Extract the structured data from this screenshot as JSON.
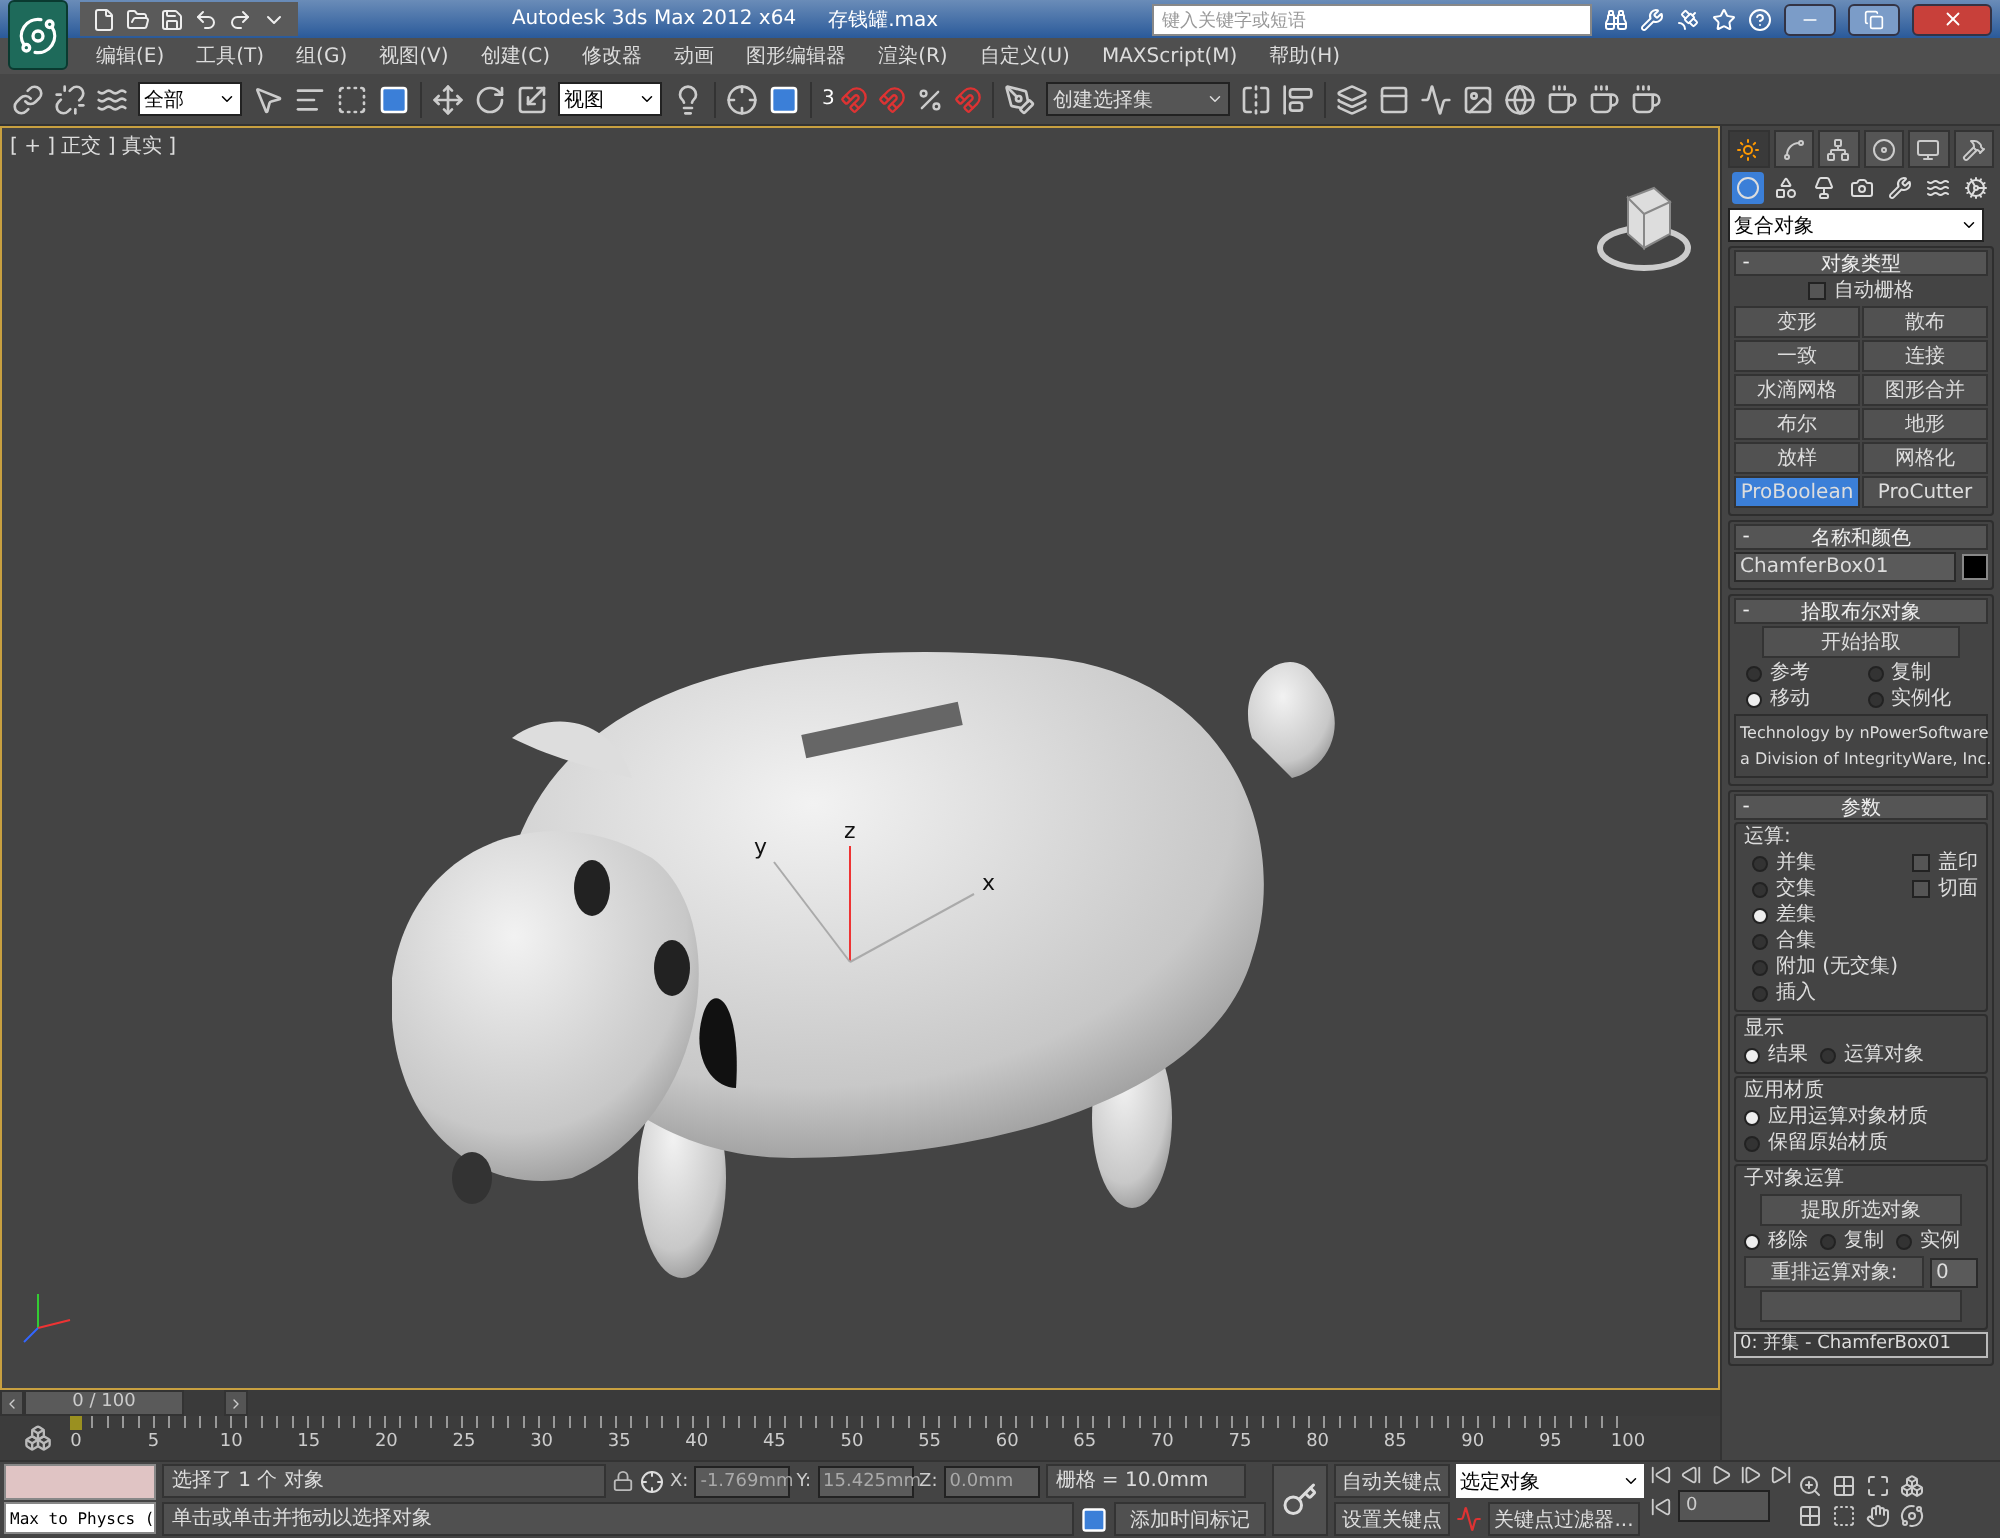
{
  "title_bar": {
    "app_title": "Autodesk 3ds Max  2012 x64",
    "file_name": "存钱罐.max",
    "search_placeholder": "键入关键字或短语"
  },
  "menu": [
    "编辑(E)",
    "工具(T)",
    "组(G)",
    "视图(V)",
    "创建(C)",
    "修改器",
    "动画",
    "图形编辑器",
    "渲染(R)",
    "自定义(U)",
    "MAXScript(M)",
    "帮助(H)"
  ],
  "toolbar": {
    "selection_filter": "全部",
    "reference_coord": "视图",
    "snap_label": "3",
    "named_selection": "创建选择集"
  },
  "viewport": {
    "label": "[ + ] 正交 ] 真实 ]",
    "gizmo_axes": [
      "x",
      "y",
      "z"
    ]
  },
  "command_panel": {
    "tabs": [
      {
        "kind": "create",
        "selected": true
      },
      {
        "kind": "modify",
        "selected": false
      },
      {
        "kind": "hierarchy",
        "selected": false
      },
      {
        "kind": "motion",
        "selected": false
      },
      {
        "kind": "display",
        "selected": false
      },
      {
        "kind": "utilities",
        "selected": false
      }
    ],
    "categories": [
      {
        "kind": "geometry",
        "selected": true
      },
      {
        "kind": "shapes",
        "selected": false
      },
      {
        "kind": "lights",
        "selected": false
      },
      {
        "kind": "cameras",
        "selected": false
      },
      {
        "kind": "helpers",
        "selected": false
      },
      {
        "kind": "spacewarps",
        "selected": false
      },
      {
        "kind": "systems",
        "selected": false
      }
    ],
    "dropdown": "复合对象",
    "object_type": {
      "mark": "-",
      "title": "对象类型",
      "auto_grid": {
        "label": "自动栅格",
        "checked": false
      },
      "buttons": [
        {
          "label": "变形",
          "selected": false
        },
        {
          "label": "散布",
          "selected": false
        },
        {
          "label": "一致",
          "selected": false
        },
        {
          "label": "连接",
          "selected": false
        },
        {
          "label": "水滴网格",
          "selected": false
        },
        {
          "label": "图形合并",
          "selected": false
        },
        {
          "label": "布尔",
          "selected": false
        },
        {
          "label": "地形",
          "selected": false
        },
        {
          "label": "放样",
          "selected": false
        },
        {
          "label": "网格化",
          "selected": false
        },
        {
          "label": "ProBoolean",
          "selected": true
        },
        {
          "label": "ProCutter",
          "selected": false
        }
      ]
    },
    "name_color": {
      "mark": "-",
      "title": "名称和颜色",
      "name": "ChamferBox01",
      "color": "#000000"
    },
    "pick": {
      "mark": "-",
      "title": "拾取布尔对象",
      "button": "开始拾取",
      "radios": [
        {
          "label": "参考",
          "selected": false
        },
        {
          "label": "复制",
          "selected": false
        },
        {
          "label": "移动",
          "selected": true
        },
        {
          "label": "实例化",
          "selected": false
        }
      ]
    },
    "credit": [
      "Technology by nPowerSoftware",
      "a Division of IntegrityWare, Inc."
    ],
    "params": {
      "mark": "-",
      "title": "参数",
      "operation": {
        "title": "运算:",
        "radios": [
          {
            "label": "并集",
            "selected": false
          },
          {
            "label": "交集",
            "selected": false
          },
          {
            "label": "差集",
            "selected": true
          },
          {
            "label": "合集",
            "selected": false
          },
          {
            "label": "附加 (无交集)",
            "selected": false
          },
          {
            "label": "插入",
            "selected": false
          }
        ],
        "checks": [
          {
            "label": "盖印",
            "checked": false
          },
          {
            "label": "切面",
            "checked": false
          }
        ]
      },
      "display": {
        "title": "显示",
        "radios": [
          {
            "label": "结果",
            "selected": true
          },
          {
            "label": "运算对象",
            "selected": false
          }
        ]
      },
      "material": {
        "title": "应用材质",
        "radios": [
          {
            "label": "应用运算对象材质",
            "selected": true
          },
          {
            "label": "保留原始材质",
            "selected": false
          }
        ]
      },
      "sub_object": {
        "title": "子对象运算",
        "button": "提取所选对象",
        "radios": [
          {
            "label": "移除",
            "selected": true
          },
          {
            "label": "复制",
            "selected": false
          },
          {
            "label": "实例",
            "selected": false
          }
        ],
        "reorder_label": "重排运算对象:",
        "reorder_value": "0",
        "list_item": "0: 并集 - ChamferBox01"
      }
    }
  },
  "timeline": {
    "frame": "0 / 100",
    "level": 0,
    "ruler_labels": [
      "0",
      "5",
      "10",
      "15",
      "20",
      "25",
      "30",
      "35",
      "40",
      "45",
      "50",
      "55",
      "60",
      "65",
      "70",
      "75",
      "80",
      "85",
      "90",
      "95",
      "100"
    ]
  },
  "status": {
    "script_label": "Max to Physcs (",
    "prompt": "选择了 1 个 对象",
    "hint": "单击或单击并拖动以选择对象",
    "x_label": "X:",
    "x": "-1.769mm",
    "y_label": "Y:",
    "y": "15.425mm",
    "z_label": "Z:",
    "z": "0.0mm",
    "grid": "栅格 = 10.0mm",
    "add_time_tag": "添加时间标记",
    "auto_key": "自动关键点",
    "set_key": "设置关键点",
    "key_mode": "选定对象",
    "key_filters": "关键点过滤器...",
    "frame": "0"
  }
}
